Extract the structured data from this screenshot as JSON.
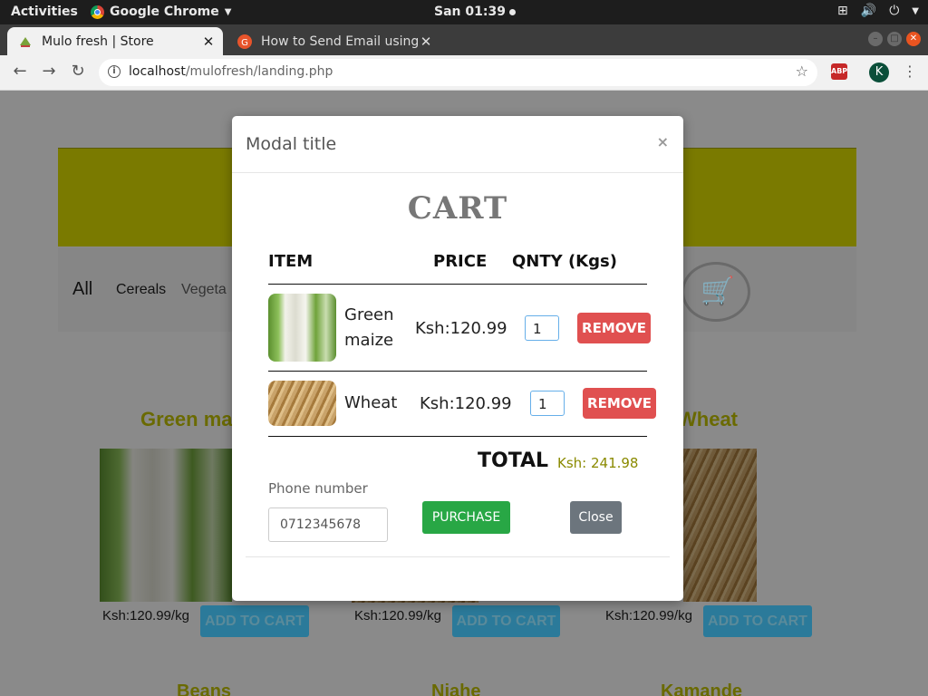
{
  "system": {
    "activities": "Activities",
    "app": "Google Chrome",
    "clock": "San 01:39"
  },
  "browser": {
    "tabs": [
      {
        "title": "Mulo fresh | Store",
        "active": true
      },
      {
        "title": "How to Send Email using",
        "active": false
      }
    ],
    "url_host": "localhost",
    "url_path": "/mulofresh/landing.php",
    "ext_badge": "ABP",
    "profile_initial": "K"
  },
  "page": {
    "categories": [
      "All",
      "Cereals",
      "Vegeta"
    ],
    "products": [
      {
        "name": "Green ma",
        "price": "Ksh:120.99",
        "unit": "/kg",
        "button": "ADD TO CART"
      },
      {
        "name": "",
        "price": "Ksh:120.99",
        "unit": "/kg",
        "button": "ADD TO CART"
      },
      {
        "name": "Wheat",
        "price": "Ksh:120.99",
        "unit": "/kg",
        "button": "ADD TO CART"
      }
    ],
    "products_row2": [
      "Beans",
      "Njahe",
      "Kamande"
    ]
  },
  "modal": {
    "title": "Modal title",
    "close_x": "×",
    "heading": "CART",
    "columns": {
      "item": "ITEM",
      "price": "PRICE",
      "qty": "QNTY (Kgs)"
    },
    "items": [
      {
        "name": "Green maize",
        "price": "Ksh:120.99",
        "qty": "1",
        "remove": "REMOVE"
      },
      {
        "name": "Wheat",
        "price": "Ksh:120.99",
        "qty": "1",
        "remove": "REMOVE"
      }
    ],
    "total_label": "TOTAL",
    "total_value": "Ksh: 241.98",
    "phone_label": "Phone number",
    "phone_placeholder": "0712345678",
    "purchase": "PURCHASE",
    "close": "Close"
  },
  "colors": {
    "brand_olive": "#7a7a00",
    "remove_red": "#e05050",
    "purchase_green": "#28a745",
    "close_gray": "#6c757d"
  }
}
